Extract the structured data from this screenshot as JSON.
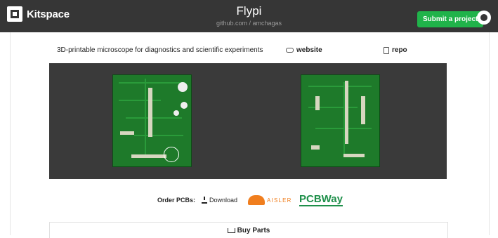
{
  "header": {
    "logo_text": "Kitspace",
    "project_title": "Flypi",
    "project_source": "github.com / amchagas",
    "submit_label": "Submit a project"
  },
  "project": {
    "description": "3D-printable microscope for diagnostics and scientific experiments",
    "website_label": "website",
    "repo_label": "repo"
  },
  "order": {
    "label": "Order PCBs:",
    "download_label": "Download",
    "aisler_label": "AISLER",
    "pcbway_label": "PCBWay"
  },
  "buy": {
    "title": "Buy Parts"
  },
  "colors": {
    "topbar": "#363636",
    "submit": "#20b34a",
    "pcb_green": "#1e7a2a",
    "aisler_orange": "#f07e1e",
    "pcbway_green": "#1e8f4a"
  },
  "icons": [
    "kitspace-logo-icon",
    "github-icon",
    "link-icon",
    "repo-icon",
    "download-icon",
    "cart-icon"
  ]
}
